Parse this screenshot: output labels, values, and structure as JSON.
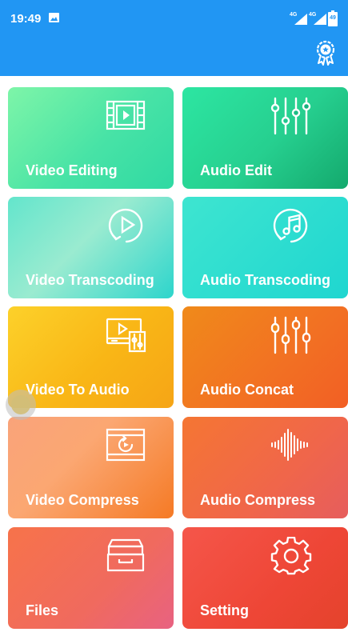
{
  "status": {
    "time": "19:49",
    "signal1": "4G",
    "signal2": "4G",
    "battery": "49"
  },
  "colors": {
    "appbar": "#2196f3"
  },
  "appbar": {
    "action_icon": "award-badge-icon"
  },
  "tiles": [
    {
      "label": "Video Editing",
      "icon": "film-play-icon"
    },
    {
      "label": "Audio Edit",
      "icon": "equalizer-sliders-icon"
    },
    {
      "label": "Video Transcoding",
      "icon": "play-circle-refresh-icon"
    },
    {
      "label": "Audio Transcoding",
      "icon": "music-note-circle-icon"
    },
    {
      "label": "Video To Audio",
      "icon": "monitor-play-sliders-icon"
    },
    {
      "label": "Audio Concat",
      "icon": "mixer-sliders-icon"
    },
    {
      "label": "Video Compress",
      "icon": "film-refresh-icon"
    },
    {
      "label": "Audio Compress",
      "icon": "sound-wave-icon"
    },
    {
      "label": "Files",
      "icon": "archive-tray-icon"
    },
    {
      "label": "Setting",
      "icon": "gear-icon"
    }
  ]
}
